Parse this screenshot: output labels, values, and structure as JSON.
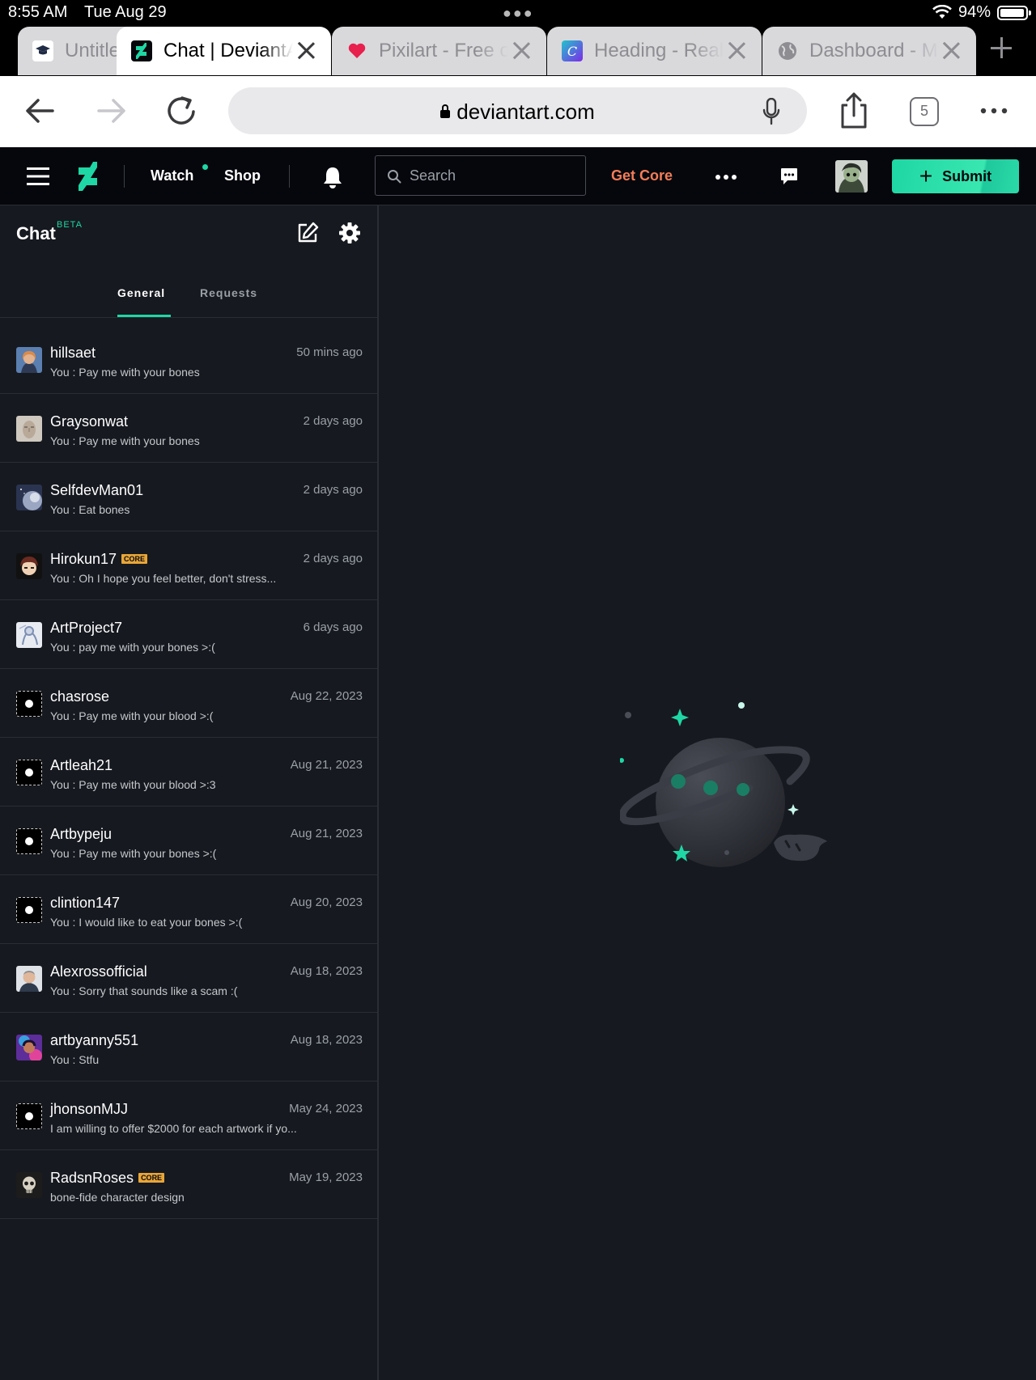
{
  "status_bar": {
    "time": "8:55 AM",
    "date": "Tue Aug 29",
    "battery": "94%"
  },
  "browser_tabs": [
    {
      "title": "Untitled",
      "favicon": "graduation-cap-icon",
      "active": false
    },
    {
      "title": "Chat | DeviantArt",
      "favicon": "deviantart-logo-icon",
      "active": true
    },
    {
      "title": "Pixilart - Free online art",
      "favicon": "heart-icon",
      "active": false
    },
    {
      "title": "Heading - Real",
      "favicon": "canva-logo-icon",
      "active": false
    },
    {
      "title": "Dashboard - My",
      "favicon": "globe-icon",
      "active": false
    }
  ],
  "toolbar": {
    "url": "deviantart.com",
    "tab_count": "5"
  },
  "nav": {
    "watch": "Watch",
    "shop": "Shop",
    "search_placeholder": "Search",
    "get_core": "Get Core",
    "submit": "Submit"
  },
  "chat": {
    "title": "Chat",
    "beta": "BETA",
    "tabs": [
      "General",
      "Requests"
    ],
    "conversations": [
      {
        "name": "hillsaet",
        "core": false,
        "message": "You : Pay me with your bones",
        "time": "50 mins ago",
        "avatar": "photo-woman"
      },
      {
        "name": "Graysonwat",
        "core": false,
        "message": "You : Pay me with your bones",
        "time": "2 days ago",
        "avatar": "photo-sculpture"
      },
      {
        "name": "SelfdevMan01",
        "core": false,
        "message": "You : Eat bones",
        "time": "2 days ago",
        "avatar": "photo-planet"
      },
      {
        "name": "Hirokun17",
        "core": true,
        "core_label": "CORE",
        "message": "You : Oh I hope you feel better, don't stress...",
        "time": "2 days ago",
        "avatar": "photo-anime"
      },
      {
        "name": "ArtProject7",
        "core": false,
        "message": "You : pay me with your bones >:(",
        "time": "6 days ago",
        "avatar": "photo-sketch"
      },
      {
        "name": "chasrose",
        "core": false,
        "message": "You : Pay me with your blood >:(",
        "time": "Aug 22, 2023",
        "avatar": "default"
      },
      {
        "name": "Artleah21",
        "core": false,
        "message": "You : Pay me with your blood >:3",
        "time": "Aug 21, 2023",
        "avatar": "default"
      },
      {
        "name": "Artbypeju",
        "core": false,
        "message": "You : Pay me with your bones >:(",
        "time": "Aug 21, 2023",
        "avatar": "default"
      },
      {
        "name": "clintion147",
        "core": false,
        "message": "You : I would like to eat your bones >:(",
        "time": "Aug 20, 2023",
        "avatar": "default"
      },
      {
        "name": "Alexrossofficial",
        "core": false,
        "message": "You : Sorry that sounds like a scam :(",
        "time": "Aug 18, 2023",
        "avatar": "photo-man"
      },
      {
        "name": "artbyanny551",
        "core": false,
        "message": "You : Stfu",
        "time": "Aug 18, 2023",
        "avatar": "photo-colorful"
      },
      {
        "name": "jhonsonMJJ",
        "core": false,
        "message": "I am willing to offer $2000 for each artwork if yo...",
        "time": "May 24, 2023",
        "avatar": "default"
      },
      {
        "name": "RadsnRoses",
        "core": true,
        "core_label": "CORE",
        "message": "bone-fide character design",
        "time": "May 19, 2023",
        "avatar": "photo-skull"
      }
    ]
  },
  "colors": {
    "accent": "#1ed7a4",
    "core_badge": "#e8a638",
    "get_core": "#f37d58",
    "background": "#16191f",
    "nav_bg": "#06070d"
  },
  "empty_state": {
    "illustration": "planet-with-ring-icon"
  }
}
